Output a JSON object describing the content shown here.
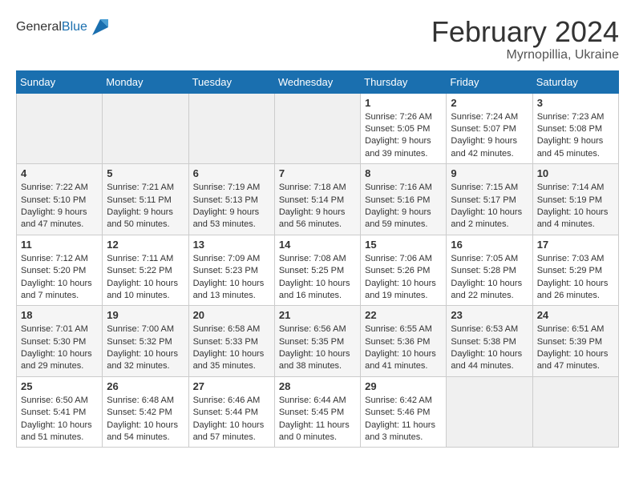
{
  "header": {
    "logo_general": "General",
    "logo_blue": "Blue",
    "month_year": "February 2024",
    "location": "Myrnopillia, Ukraine"
  },
  "calendar": {
    "days_of_week": [
      "Sunday",
      "Monday",
      "Tuesday",
      "Wednesday",
      "Thursday",
      "Friday",
      "Saturday"
    ],
    "weeks": [
      [
        {
          "day": "",
          "info": ""
        },
        {
          "day": "",
          "info": ""
        },
        {
          "day": "",
          "info": ""
        },
        {
          "day": "",
          "info": ""
        },
        {
          "day": "1",
          "info": "Sunrise: 7:26 AM\nSunset: 5:05 PM\nDaylight: 9 hours and 39 minutes."
        },
        {
          "day": "2",
          "info": "Sunrise: 7:24 AM\nSunset: 5:07 PM\nDaylight: 9 hours and 42 minutes."
        },
        {
          "day": "3",
          "info": "Sunrise: 7:23 AM\nSunset: 5:08 PM\nDaylight: 9 hours and 45 minutes."
        }
      ],
      [
        {
          "day": "4",
          "info": "Sunrise: 7:22 AM\nSunset: 5:10 PM\nDaylight: 9 hours and 47 minutes."
        },
        {
          "day": "5",
          "info": "Sunrise: 7:21 AM\nSunset: 5:11 PM\nDaylight: 9 hours and 50 minutes."
        },
        {
          "day": "6",
          "info": "Sunrise: 7:19 AM\nSunset: 5:13 PM\nDaylight: 9 hours and 53 minutes."
        },
        {
          "day": "7",
          "info": "Sunrise: 7:18 AM\nSunset: 5:14 PM\nDaylight: 9 hours and 56 minutes."
        },
        {
          "day": "8",
          "info": "Sunrise: 7:16 AM\nSunset: 5:16 PM\nDaylight: 9 hours and 59 minutes."
        },
        {
          "day": "9",
          "info": "Sunrise: 7:15 AM\nSunset: 5:17 PM\nDaylight: 10 hours and 2 minutes."
        },
        {
          "day": "10",
          "info": "Sunrise: 7:14 AM\nSunset: 5:19 PM\nDaylight: 10 hours and 4 minutes."
        }
      ],
      [
        {
          "day": "11",
          "info": "Sunrise: 7:12 AM\nSunset: 5:20 PM\nDaylight: 10 hours and 7 minutes."
        },
        {
          "day": "12",
          "info": "Sunrise: 7:11 AM\nSunset: 5:22 PM\nDaylight: 10 hours and 10 minutes."
        },
        {
          "day": "13",
          "info": "Sunrise: 7:09 AM\nSunset: 5:23 PM\nDaylight: 10 hours and 13 minutes."
        },
        {
          "day": "14",
          "info": "Sunrise: 7:08 AM\nSunset: 5:25 PM\nDaylight: 10 hours and 16 minutes."
        },
        {
          "day": "15",
          "info": "Sunrise: 7:06 AM\nSunset: 5:26 PM\nDaylight: 10 hours and 19 minutes."
        },
        {
          "day": "16",
          "info": "Sunrise: 7:05 AM\nSunset: 5:28 PM\nDaylight: 10 hours and 22 minutes."
        },
        {
          "day": "17",
          "info": "Sunrise: 7:03 AM\nSunset: 5:29 PM\nDaylight: 10 hours and 26 minutes."
        }
      ],
      [
        {
          "day": "18",
          "info": "Sunrise: 7:01 AM\nSunset: 5:30 PM\nDaylight: 10 hours and 29 minutes."
        },
        {
          "day": "19",
          "info": "Sunrise: 7:00 AM\nSunset: 5:32 PM\nDaylight: 10 hours and 32 minutes."
        },
        {
          "day": "20",
          "info": "Sunrise: 6:58 AM\nSunset: 5:33 PM\nDaylight: 10 hours and 35 minutes."
        },
        {
          "day": "21",
          "info": "Sunrise: 6:56 AM\nSunset: 5:35 PM\nDaylight: 10 hours and 38 minutes."
        },
        {
          "day": "22",
          "info": "Sunrise: 6:55 AM\nSunset: 5:36 PM\nDaylight: 10 hours and 41 minutes."
        },
        {
          "day": "23",
          "info": "Sunrise: 6:53 AM\nSunset: 5:38 PM\nDaylight: 10 hours and 44 minutes."
        },
        {
          "day": "24",
          "info": "Sunrise: 6:51 AM\nSunset: 5:39 PM\nDaylight: 10 hours and 47 minutes."
        }
      ],
      [
        {
          "day": "25",
          "info": "Sunrise: 6:50 AM\nSunset: 5:41 PM\nDaylight: 10 hours and 51 minutes."
        },
        {
          "day": "26",
          "info": "Sunrise: 6:48 AM\nSunset: 5:42 PM\nDaylight: 10 hours and 54 minutes."
        },
        {
          "day": "27",
          "info": "Sunrise: 6:46 AM\nSunset: 5:44 PM\nDaylight: 10 hours and 57 minutes."
        },
        {
          "day": "28",
          "info": "Sunrise: 6:44 AM\nSunset: 5:45 PM\nDaylight: 11 hours and 0 minutes."
        },
        {
          "day": "29",
          "info": "Sunrise: 6:42 AM\nSunset: 5:46 PM\nDaylight: 11 hours and 3 minutes."
        },
        {
          "day": "",
          "info": ""
        },
        {
          "day": "",
          "info": ""
        }
      ]
    ]
  }
}
